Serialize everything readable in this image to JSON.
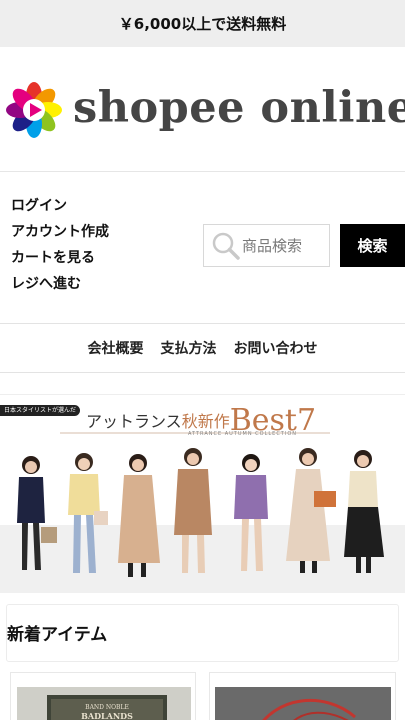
{
  "announcement": "￥6,000以上で送料無料",
  "site": {
    "logo_text": "shopee online",
    "brand_colors": [
      "#e6332a",
      "#f39800",
      "#fff100",
      "#8fc31f",
      "#00a0e9",
      "#1d2088",
      "#920783",
      "#e4007f"
    ]
  },
  "account_links": [
    "ログイン",
    "アカウント作成",
    "カートを見る",
    "レジへ進む"
  ],
  "search": {
    "placeholder": "商品検索",
    "button_label": "検索",
    "icon": "magnifier-icon"
  },
  "footer_nav": [
    "会社概要",
    "支払方法",
    "お問い合わせ"
  ],
  "banner": {
    "tag": "日本スタイリストが選んだ",
    "title_part1": "アットランス",
    "title_part2": "秋新作",
    "title_part3": "Best7",
    "subtitle": "ATTRANCE AUTUMN COLLECTION"
  },
  "new_items": {
    "heading": "新着アイテム"
  },
  "products": [
    {
      "thumb_label_1": "BAND NOBLE",
      "thumb_label_2": "BADLANDS"
    },
    {
      "thumb_label_1": ""
    }
  ]
}
